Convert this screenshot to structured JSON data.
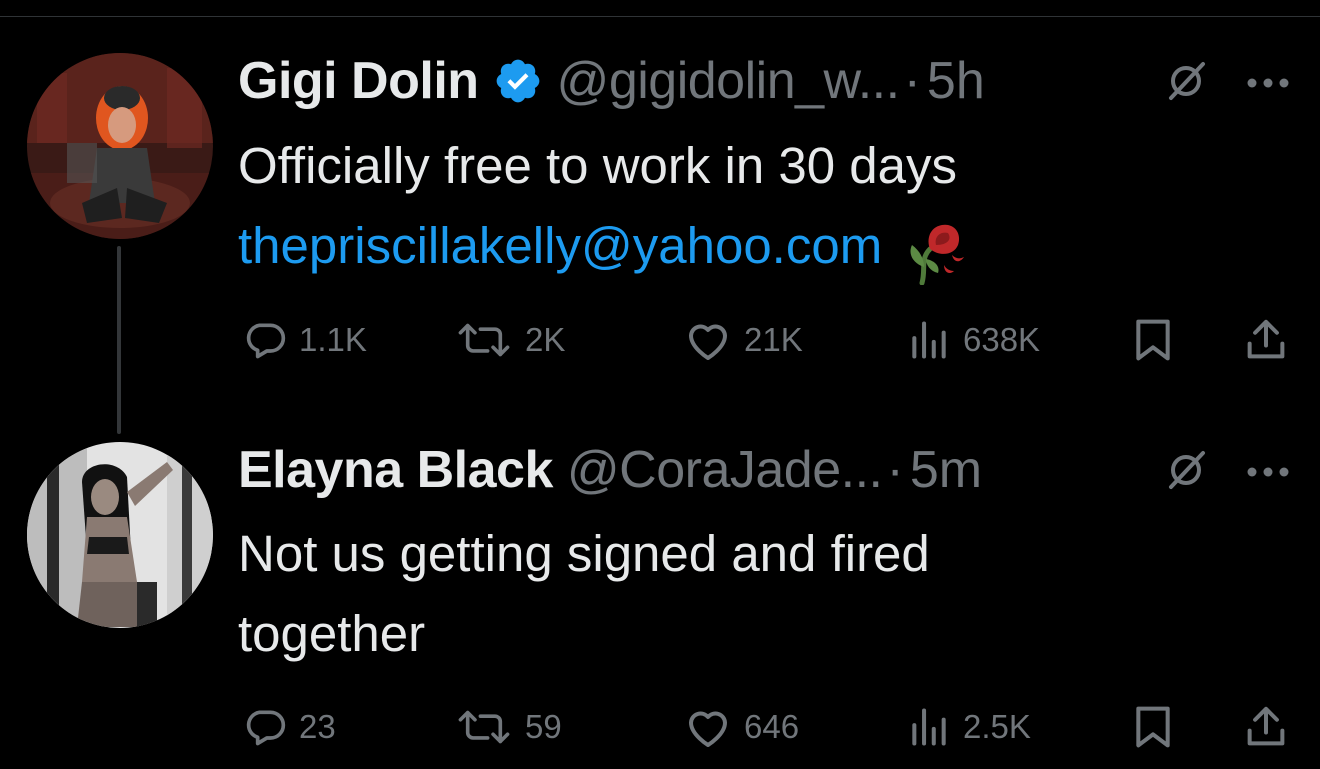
{
  "tweets": [
    {
      "display_name": "Gigi Dolin",
      "verified": true,
      "handle": "@gigidolin_w...",
      "dot": "·",
      "time": "5h",
      "text_line_1": "Officially free to work in 30 days",
      "link": "thepriscillakelly@yahoo.com",
      "emoji": "wilted-rose",
      "stats": {
        "replies": "1.1K",
        "reposts": "2K",
        "likes": "21K",
        "views": "638K"
      }
    },
    {
      "display_name": "Elayna Black",
      "verified": false,
      "handle": "@CoraJade...",
      "dot": "·",
      "time": "5m",
      "text_line_1": "Not us getting signed and fired",
      "text_line_2": "together",
      "stats": {
        "replies": "23",
        "reposts": "59",
        "likes": "646",
        "views": "2.5K"
      }
    }
  ],
  "icons": {
    "reply": "reply-icon",
    "repost": "repost-icon",
    "like": "heart-icon",
    "views": "views-icon",
    "bookmark": "bookmark-icon",
    "share": "share-icon",
    "grok": "grok-icon",
    "more": "more-icon",
    "verified": "verified-badge-icon"
  },
  "colors": {
    "background": "#000000",
    "text": "#e7e9ea",
    "muted": "#71767b",
    "link": "#1d9bf0",
    "verified": "#1d9bf0",
    "thread_line": "#333639"
  }
}
